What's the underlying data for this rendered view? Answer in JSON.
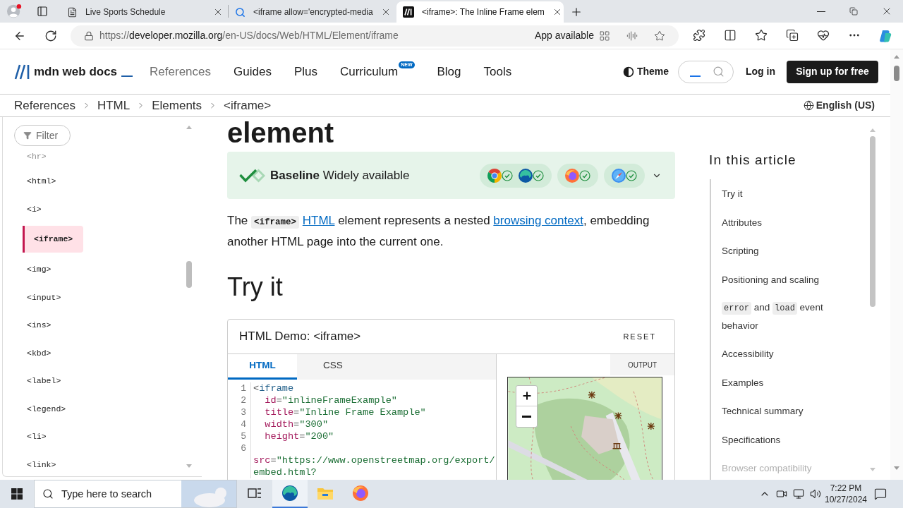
{
  "browser": {
    "tabs": [
      {
        "kind": "page",
        "title": "Live Sports Schedule",
        "selected": false
      },
      {
        "kind": "search",
        "title": "<iframe allow='encrypted-media",
        "selected": false
      },
      {
        "kind": "mdn",
        "title": "<iframe>: The Inline Frame elem",
        "selected": true
      }
    ],
    "url": {
      "scheme": "https://",
      "host": "developer.mozilla.org",
      "path": "/en-US/docs/Web/HTML/Element/iframe"
    },
    "app_available": "App available"
  },
  "header": {
    "logo": "mdn web docs",
    "nav": [
      {
        "label": "References",
        "muted": true
      },
      {
        "label": "Guides",
        "muted": false
      },
      {
        "label": "Plus",
        "muted": false
      },
      {
        "label": "Curriculum",
        "muted": false,
        "badge": "NEW"
      },
      {
        "label": "Blog",
        "muted": false
      },
      {
        "label": "Tools",
        "muted": false
      }
    ],
    "theme": "Theme",
    "login": "Log in",
    "signup": "Sign up for free"
  },
  "breadcrumbs": {
    "items": [
      "References",
      "HTML",
      "Elements",
      "<iframe>"
    ],
    "language": "English (US)"
  },
  "sidebar": {
    "filter": "Filter",
    "items": [
      {
        "label": "<hr>",
        "selected": false,
        "faded": true
      },
      {
        "label": "<html>",
        "selected": false,
        "faded": false
      },
      {
        "label": "<i>",
        "selected": false,
        "faded": false
      },
      {
        "label": "<iframe>",
        "selected": true,
        "faded": false
      },
      {
        "label": "<img>",
        "selected": false,
        "faded": false
      },
      {
        "label": "<input>",
        "selected": false,
        "faded": false
      },
      {
        "label": "<ins>",
        "selected": false,
        "faded": false
      },
      {
        "label": "<kbd>",
        "selected": false,
        "faded": false
      },
      {
        "label": "<label>",
        "selected": false,
        "faded": false
      },
      {
        "label": "<legend>",
        "selected": false,
        "faded": false
      },
      {
        "label": "<li>",
        "selected": false,
        "faded": false
      },
      {
        "label": "<link>",
        "selected": false,
        "faded": false
      }
    ]
  },
  "article": {
    "heading": "element",
    "baseline": {
      "status": "**Baseline** Widely available",
      "browser_groups": [
        {
          "browsers": [
            {
              "kind": "chrome",
              "supported": true
            },
            {
              "kind": "edge",
              "supported": true
            }
          ]
        },
        {
          "browsers": [
            {
              "kind": "firefox",
              "supported": true
            }
          ]
        },
        {
          "browsers": [
            {
              "kind": "safari",
              "supported": true
            }
          ]
        }
      ]
    },
    "intro": [
      {
        "kind": "text",
        "text": "The "
      },
      {
        "kind": "code",
        "text": "<iframe>"
      },
      {
        "kind": "link",
        "text": "HTML"
      },
      {
        "kind": "text",
        "text": " element represents a nested "
      },
      {
        "kind": "link",
        "text": "browsing context"
      },
      {
        "kind": "text",
        "text": ", embedding another HTML page into the current one."
      }
    ],
    "try_it": "Try it",
    "demo": {
      "title": "HTML Demo: <iframe>",
      "reset": "RESET",
      "tabs": [
        {
          "label": "HTML",
          "selected": true
        },
        {
          "label": "CSS",
          "selected": false
        }
      ],
      "output": "OUTPUT",
      "lines": [
        {
          "number": "1",
          "tokens": [
            {
              "kind": "punct",
              "text": "<"
            },
            {
              "kind": "tag",
              "text": "iframe"
            }
          ]
        },
        {
          "number": "2",
          "tokens": [
            {
              "kind": "attr",
              "text": "  id"
            },
            {
              "kind": "punct",
              "text": "="
            },
            {
              "kind": "string",
              "text": "\"inlineFrameExample\""
            }
          ]
        },
        {
          "number": "3",
          "tokens": [
            {
              "kind": "attr",
              "text": "  title"
            },
            {
              "kind": "punct",
              "text": "="
            },
            {
              "kind": "string",
              "text": "\"Inline Frame Example\""
            }
          ]
        },
        {
          "number": "4",
          "tokens": [
            {
              "kind": "attr",
              "text": "  width"
            },
            {
              "kind": "punct",
              "text": "="
            },
            {
              "kind": "string",
              "text": "\"300\""
            }
          ]
        },
        {
          "number": "5",
          "tokens": [
            {
              "kind": "attr",
              "text": "  height"
            },
            {
              "kind": "punct",
              "text": "="
            },
            {
              "kind": "string",
              "text": "\"200\""
            }
          ]
        },
        {
          "number": "6"
        },
        {
          "tokens": [
            {
              "kind": "attr",
              "text": "src"
            },
            {
              "kind": "punct",
              "text": "="
            },
            {
              "kind": "string",
              "text": "\"https://www.openstreetmap.org/export/"
            }
          ]
        },
        {
          "tokens": [
            {
              "kind": "string",
              "text": "embed.html?"
            }
          ]
        }
      ]
    }
  },
  "toc": {
    "title": "In this article",
    "items": [
      {
        "label": "Try it",
        "faded": false
      },
      {
        "label": "Attributes",
        "faded": false
      },
      {
        "label": "Scripting",
        "faded": false
      },
      {
        "label": "Positioning and scaling",
        "faded": false
      },
      {
        "parts": [
          {
            "kind": "code",
            "text": "error"
          },
          {
            "kind": "text",
            "text": " and "
          },
          {
            "kind": "code",
            "text": "load"
          },
          {
            "kind": "text",
            "text": " event behavior"
          }
        ],
        "faded": false
      },
      {
        "label": "Accessibility",
        "faded": false
      },
      {
        "label": "Examples",
        "faded": false
      },
      {
        "label": "Technical summary",
        "faded": false
      },
      {
        "label": "Specifications",
        "faded": false
      },
      {
        "label": "Browser compatibility",
        "faded": true
      }
    ]
  },
  "taskbar": {
    "search_placeholder": "Type here to search",
    "apps": [
      {
        "kind": "task_view",
        "active": false
      },
      {
        "kind": "edge",
        "active": true
      },
      {
        "kind": "explorer",
        "active": false
      },
      {
        "kind": "firefox",
        "active": false
      }
    ],
    "time": "7:22 PM",
    "date": "10/27/2024"
  }
}
